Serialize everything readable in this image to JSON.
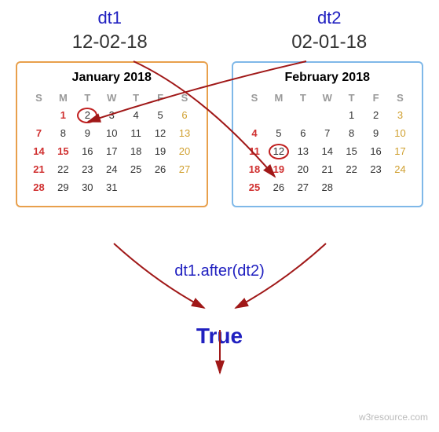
{
  "labels": {
    "dt1": {
      "name": "dt1",
      "value": "12-02-18"
    },
    "dt2": {
      "name": "dt2",
      "value": "02-01-18"
    }
  },
  "calendars": {
    "jan": {
      "title": "January 2018",
      "dow": [
        "S",
        "M",
        "T",
        "W",
        "T",
        "F",
        "S"
      ],
      "weeks": [
        [
          "",
          {
            "d": "1",
            "cls": "holiday"
          },
          {
            "d": "2",
            "cls": "circled"
          },
          "3",
          "4",
          "5",
          {
            "d": "6",
            "cls": "sat"
          }
        ],
        [
          {
            "d": "7",
            "cls": "sun"
          },
          "8",
          "9",
          "10",
          "11",
          "12",
          {
            "d": "13",
            "cls": "sat"
          }
        ],
        [
          {
            "d": "14",
            "cls": "sun"
          },
          {
            "d": "15",
            "cls": "holiday"
          },
          "16",
          "17",
          "18",
          "19",
          {
            "d": "20",
            "cls": "sat"
          }
        ],
        [
          {
            "d": "21",
            "cls": "sun"
          },
          "22",
          "23",
          "24",
          "25",
          "26",
          {
            "d": "27",
            "cls": "sat"
          }
        ],
        [
          {
            "d": "28",
            "cls": "sun"
          },
          "29",
          "30",
          "31",
          "",
          "",
          ""
        ]
      ]
    },
    "feb": {
      "title": "February 2018",
      "dow": [
        "S",
        "M",
        "T",
        "W",
        "T",
        "F",
        "S"
      ],
      "weeks": [
        [
          "",
          "",
          "",
          "",
          "1",
          "2",
          {
            "d": "3",
            "cls": "sat"
          }
        ],
        [
          {
            "d": "4",
            "cls": "sun"
          },
          "5",
          "6",
          "7",
          "8",
          "9",
          {
            "d": "10",
            "cls": "sat"
          }
        ],
        [
          {
            "d": "11",
            "cls": "sun"
          },
          {
            "d": "12",
            "cls": "circled"
          },
          "13",
          "14",
          "15",
          "16",
          {
            "d": "17",
            "cls": "sat"
          }
        ],
        [
          {
            "d": "18",
            "cls": "sun"
          },
          {
            "d": "19",
            "cls": "holiday"
          },
          "20",
          "21",
          "22",
          "23",
          {
            "d": "24",
            "cls": "sat"
          }
        ],
        [
          {
            "d": "25",
            "cls": "sun"
          },
          "26",
          "27",
          "28",
          "",
          "",
          ""
        ]
      ]
    }
  },
  "expression": "dt1.after(dt2)",
  "result": "True",
  "watermark": "w3resource.com"
}
